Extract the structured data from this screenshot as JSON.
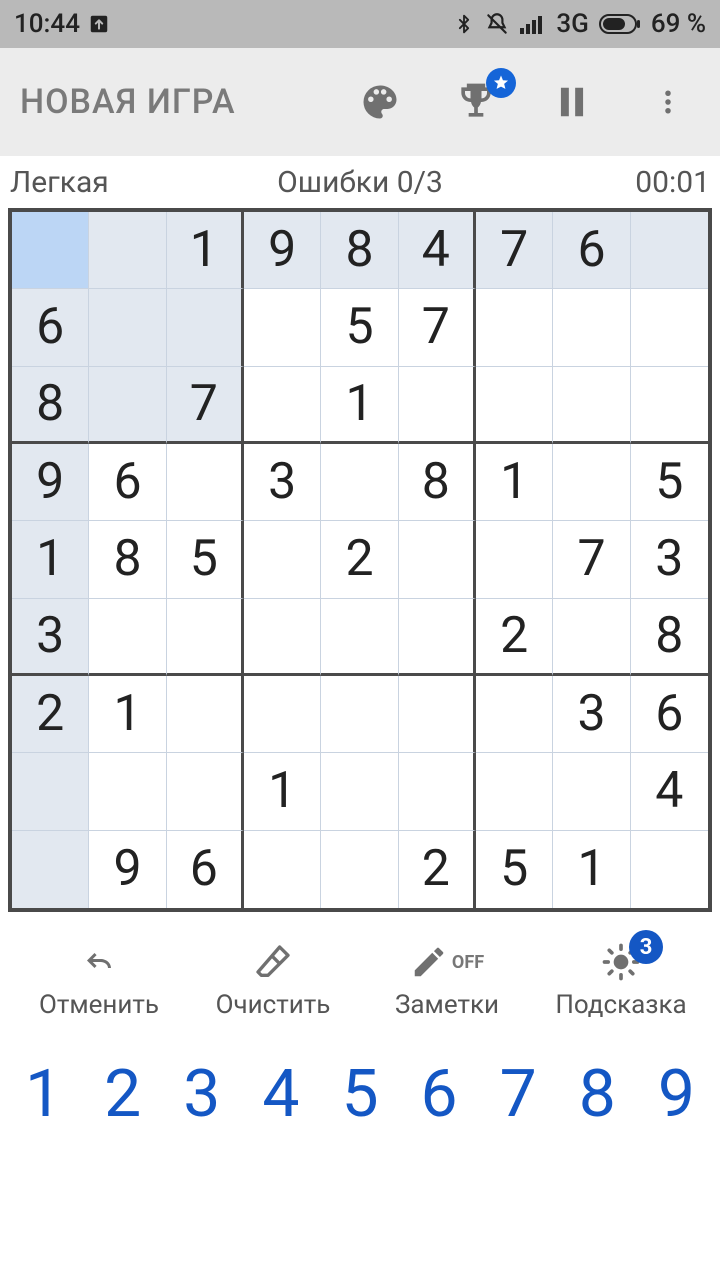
{
  "status": {
    "time": "10:44",
    "network": "3G",
    "battery": "69 %"
  },
  "appbar": {
    "title": "НОВАЯ ИГРА"
  },
  "info": {
    "difficulty": "Легкая",
    "mistakes": "Ошибки 0/3",
    "timer": "00:01"
  },
  "board": {
    "selected": [
      0,
      0
    ],
    "rows": [
      [
        "",
        "",
        "1",
        "9",
        "8",
        "4",
        "7",
        "6",
        ""
      ],
      [
        "6",
        "",
        "",
        "",
        "5",
        "7",
        "",
        "",
        ""
      ],
      [
        "8",
        "",
        "7",
        "",
        "1",
        "",
        "",
        "",
        ""
      ],
      [
        "9",
        "6",
        "",
        "3",
        "",
        "8",
        "1",
        "",
        "5"
      ],
      [
        "1",
        "8",
        "5",
        "",
        "2",
        "",
        "",
        "7",
        "3"
      ],
      [
        "3",
        "",
        "",
        "",
        "",
        "",
        "2",
        "",
        "8"
      ],
      [
        "2",
        "1",
        "",
        "",
        "",
        "",
        "",
        "3",
        "6"
      ],
      [
        "",
        "",
        "",
        "1",
        "",
        "",
        "",
        "",
        "4"
      ],
      [
        "",
        "9",
        "6",
        "",
        "",
        "2",
        "5",
        "1",
        ""
      ]
    ]
  },
  "tools": {
    "undo": "Отменить",
    "erase": "Очистить",
    "notes": "Заметки",
    "notes_state": "OFF",
    "hint": "Подсказка",
    "hint_count": "3"
  },
  "numpad": [
    "1",
    "2",
    "3",
    "4",
    "5",
    "6",
    "7",
    "8",
    "9"
  ]
}
